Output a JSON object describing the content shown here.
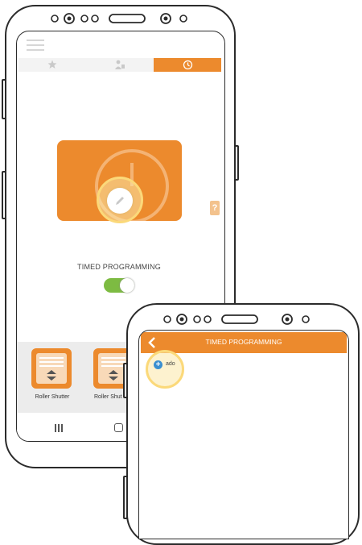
{
  "phone1": {
    "tabs": [
      {
        "icon": "star-icon",
        "active": false
      },
      {
        "icon": "person-icon",
        "active": false
      },
      {
        "icon": "clock-icon",
        "active": true
      }
    ],
    "help_badge": "?",
    "timed_programming_label": "TIMED PROGRAMMING",
    "toggle_on": true,
    "devices": [
      {
        "label": "Roller Shutter",
        "icon": "roller-shutter-icon"
      },
      {
        "label": "Roller Shut",
        "icon": "roller-shutter-icon"
      }
    ],
    "nav": [
      "recent-apps-icon",
      "home-icon"
    ]
  },
  "phone2": {
    "header_title": "TIMED PROGRAMMING",
    "back_icon": "back-arrow-icon",
    "add_label": "ado",
    "add_icon": "add-circle-icon"
  },
  "colors": {
    "accent": "#ec8a2d",
    "toggle": "#7dbb42",
    "highlight": "#fbe7a8",
    "add_button": "#3a8fd0"
  }
}
